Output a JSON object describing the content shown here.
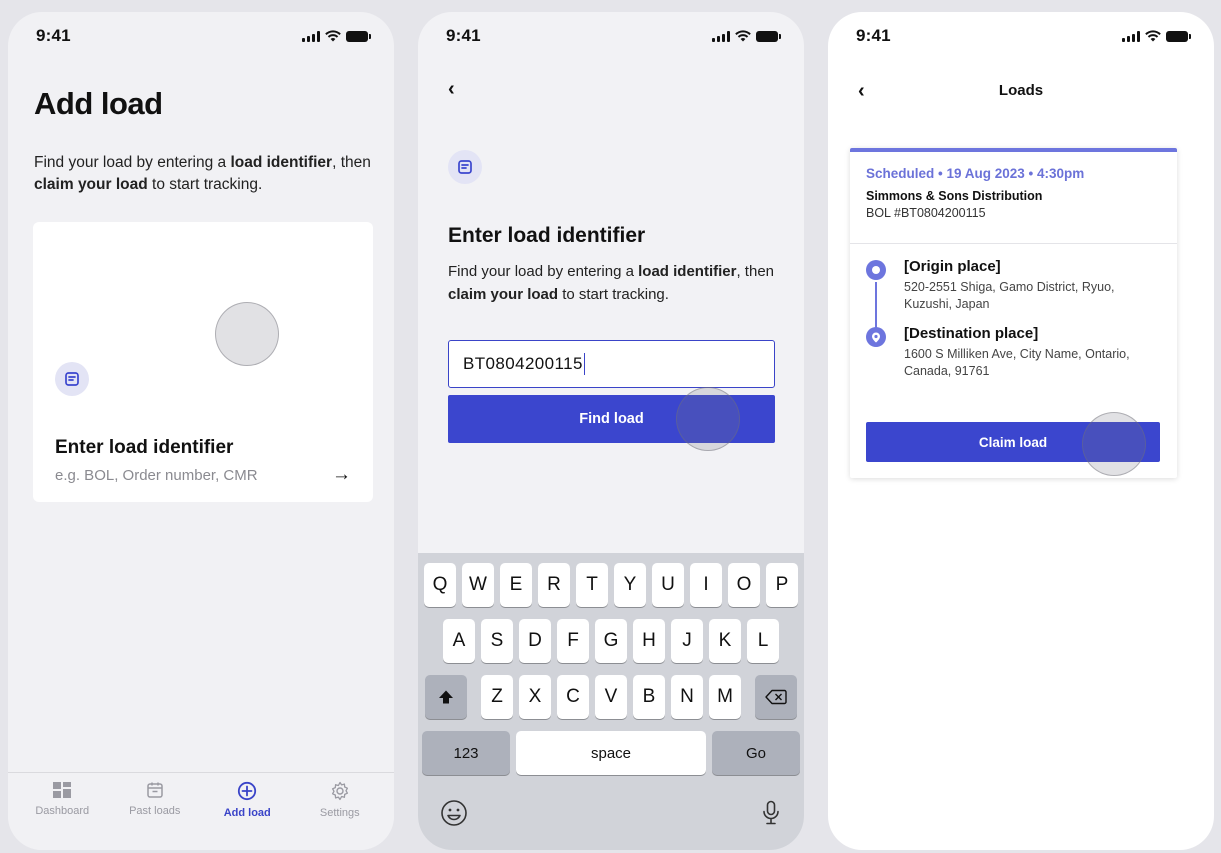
{
  "status_bar": {
    "time": "9:41"
  },
  "screen1": {
    "title": "Add load",
    "intro": {
      "p1": "Find your load by entering a ",
      "b1": "load identifier",
      "p2": ", then ",
      "b2": "claim your load",
      "p3": " to start tracking."
    },
    "card": {
      "title": "Enter load identifier",
      "hint": "e.g. BOL, Order number, CMR",
      "arrow": "→"
    },
    "tabs": [
      {
        "label": "Dashboard",
        "icon": "dashboard-icon"
      },
      {
        "label": "Past loads",
        "icon": "calendar-icon"
      },
      {
        "label": "Add load",
        "icon": "plus-circle-icon",
        "active": true
      },
      {
        "label": "Settings",
        "icon": "gear-icon"
      }
    ]
  },
  "screen2": {
    "back": "‹",
    "title": "Enter load identifier",
    "intro": {
      "p1": "Find your load by entering a ",
      "b1": "load identifier",
      "p2": ", then ",
      "b2": "claim your load",
      "p3": " to start tracking."
    },
    "input_value": "BT0804200115",
    "find_button": "Find load",
    "keyboard": {
      "row1": [
        "Q",
        "W",
        "E",
        "R",
        "T",
        "Y",
        "U",
        "I",
        "O",
        "P"
      ],
      "row2": [
        "A",
        "S",
        "D",
        "F",
        "G",
        "H",
        "J",
        "K",
        "L"
      ],
      "row3": [
        "Z",
        "X",
        "C",
        "V",
        "B",
        "N",
        "M"
      ],
      "num": "123",
      "space": "space",
      "go": "Go"
    }
  },
  "screen3": {
    "back": "‹",
    "title": "Loads",
    "load": {
      "status": "Scheduled • 19 Aug 2023 • 4:30pm",
      "shipper": "Simmons & Sons Distribution",
      "bol": "BOL #BT0804200115",
      "origin_name": "[Origin place]",
      "origin_addr": "520-2551 Shiga, Gamo District, Ryuo, Kuzushi, Japan",
      "dest_name": "[Destination place]",
      "dest_addr": "1600 S Milliken Ave, City Name, Ontario, Canada, 91761",
      "claim_button": "Claim load"
    }
  },
  "colors": {
    "accent": "#3b46ce",
    "accent_light": "#6d75de",
    "badge_bg": "#e3e4f5"
  }
}
